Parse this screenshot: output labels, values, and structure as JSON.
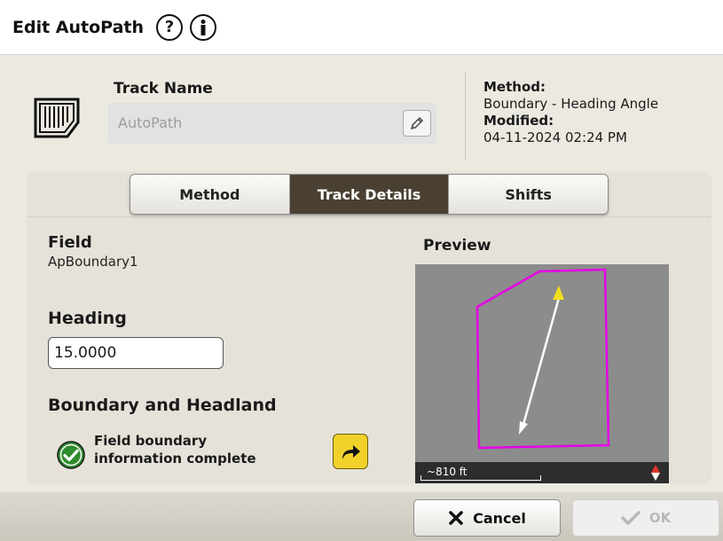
{
  "title": "Edit AutoPath",
  "header": {
    "track_name_label": "Track Name",
    "track_name_value": "AutoPath",
    "method_key": "Method:",
    "method_value": "Boundary - Heading Angle",
    "modified_key": "Modified:",
    "modified_value": "04-11-2024 02:24 PM"
  },
  "tabs": [
    {
      "label": "Method",
      "active": false
    },
    {
      "label": "Track Details",
      "active": true
    },
    {
      "label": "Shifts",
      "active": false
    }
  ],
  "details": {
    "field_label": "Field",
    "field_value": "ApBoundary1",
    "heading_label": "Heading",
    "heading_value": "15.0000",
    "boundary_label": "Boundary and Headland",
    "status_line1": "Field boundary",
    "status_line2": "information complete"
  },
  "preview": {
    "label": "Preview",
    "scale": "~810 ft",
    "boundary_color": "#e600e6",
    "track_arrow_color": "#ffffff",
    "direction_marker_color": "#f2e01c"
  },
  "footer": {
    "cancel_label": "Cancel",
    "ok_label": "OK"
  },
  "icons": {
    "help": "question-circle-icon",
    "info": "info-circle-icon",
    "track": "track-grid-icon",
    "edit": "pencil-icon",
    "status": "check-circle-icon",
    "go": "arrow-redirect-icon",
    "compass": "compass-icon",
    "cancel": "x-icon",
    "ok": "checkmark-icon"
  }
}
